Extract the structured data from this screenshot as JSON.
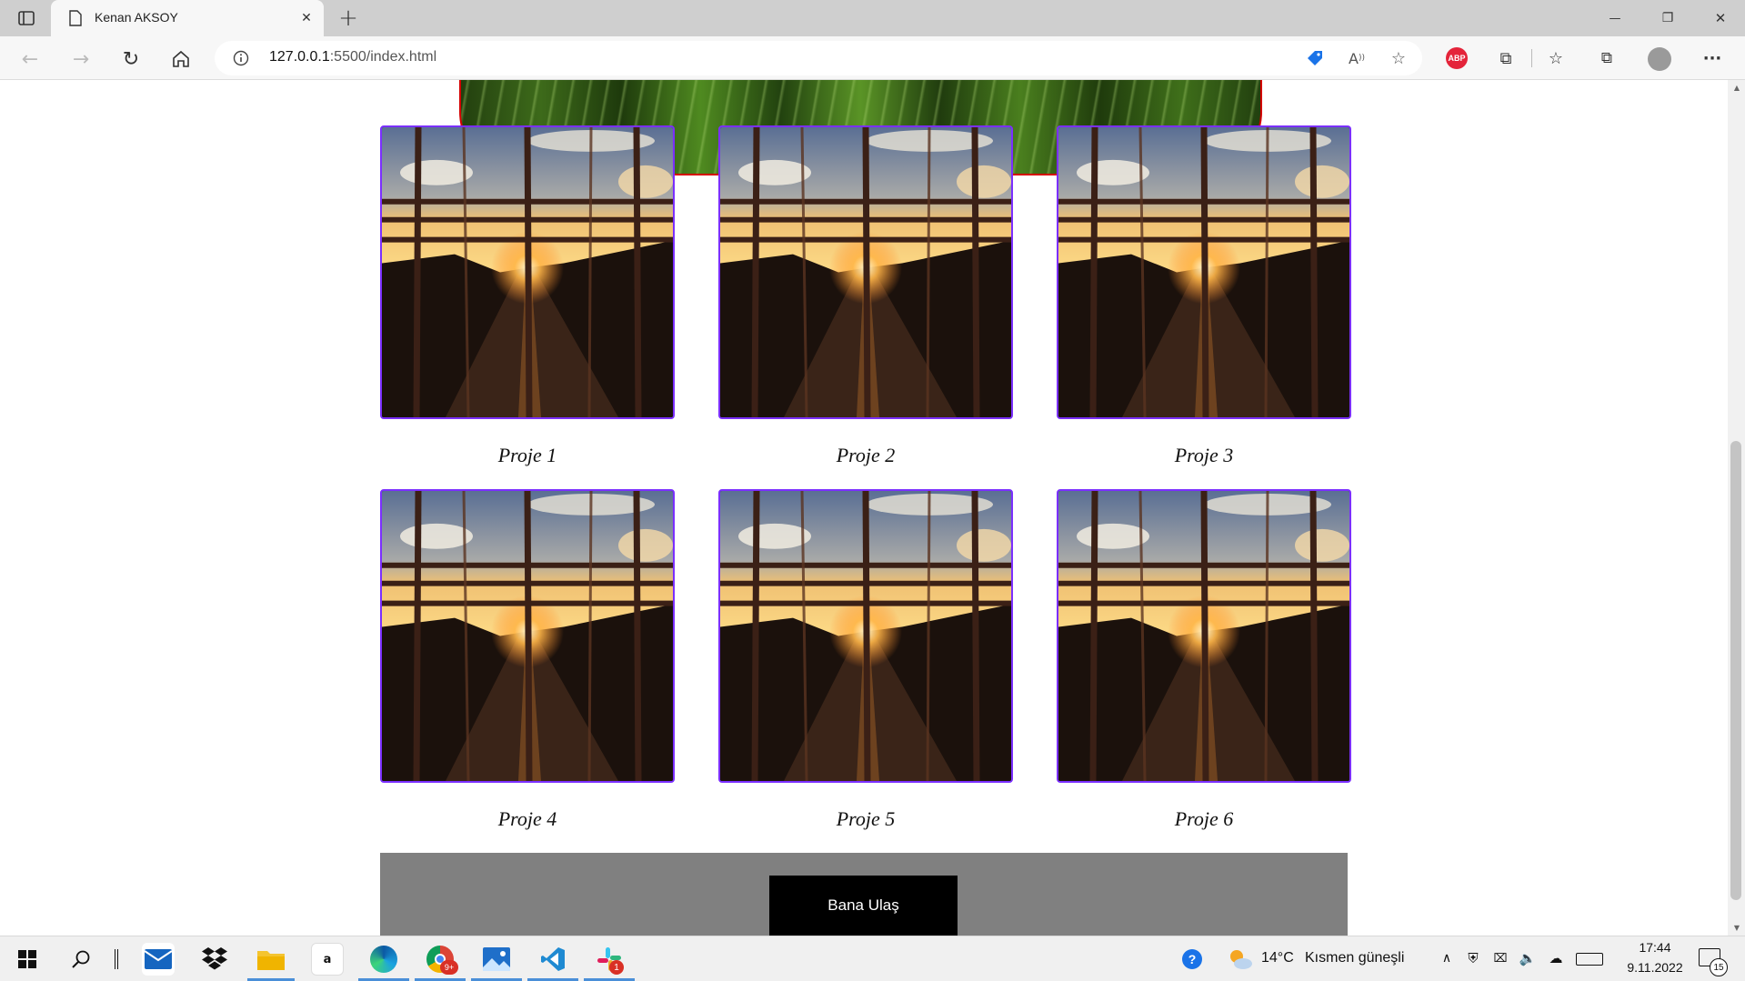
{
  "browser": {
    "tab_title": "Kenan AKSOY",
    "tab_close": "✕",
    "new_tab": "+",
    "address_host": "127.0.0.1",
    "address_path": ":5500/index.html",
    "window_minimize": "—",
    "window_restore": "❐",
    "window_close": "✕",
    "menu": "···"
  },
  "projects": [
    {
      "label": "Proje 1"
    },
    {
      "label": "Proje 2"
    },
    {
      "label": "Proje 3"
    },
    {
      "label": "Proje 4"
    },
    {
      "label": "Proje 5"
    },
    {
      "label": "Proje 6"
    }
  ],
  "footer": {
    "contact_button": "Bana Ulaş"
  },
  "taskbar": {
    "weather_temp": "14°C",
    "weather_text": "Kısmen güneşli",
    "time": "17:44",
    "date": "9.11.2022",
    "notification_count": "15",
    "slack_badge": "1",
    "chrome_badge": "9+"
  },
  "colors": {
    "photo_border": "#7b2fff",
    "footer_bg": "#808080",
    "button_bg": "#000000",
    "hero_border": "#d40000"
  }
}
